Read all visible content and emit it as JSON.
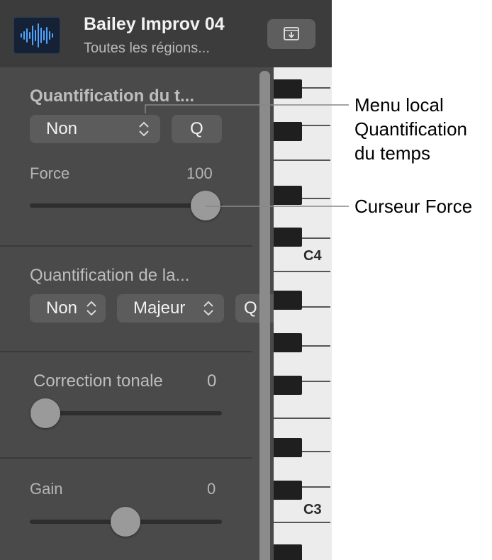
{
  "header": {
    "title": "Bailey Improv 04",
    "subtitle": "Toutes les régions..."
  },
  "time_quantize": {
    "label": "Quantification du t...",
    "popup_value": "Non",
    "q_button": "Q",
    "strength_label": "Force",
    "strength_value": "100",
    "strength_level": 100
  },
  "scale_quantize": {
    "label": "Quantification de la...",
    "popup1_value": "Non",
    "popup2_value": "Majeur",
    "button_partial": "Q"
  },
  "pitch_correction": {
    "label": "Correction tonale",
    "value": "0"
  },
  "gain": {
    "label": "Gain",
    "value": "0"
  },
  "keyboard": {
    "c4_label": "C4",
    "c3_label": "C3"
  },
  "callouts": {
    "menu_line1": "Menu local",
    "menu_line2": "Quantification",
    "menu_line3": "du temps",
    "slider": "Curseur Force"
  }
}
